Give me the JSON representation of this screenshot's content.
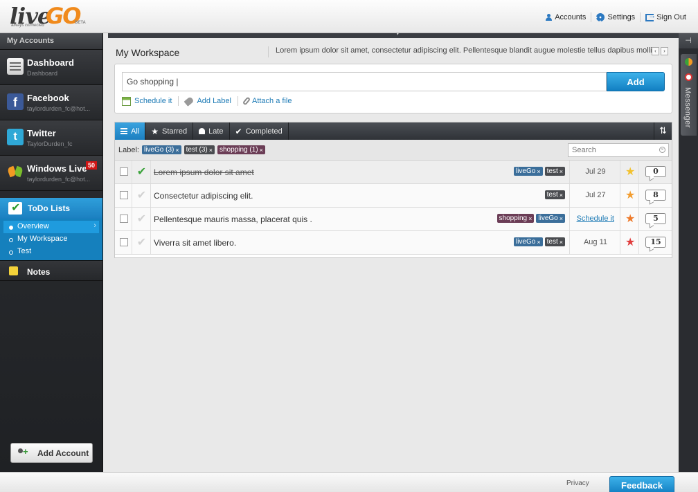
{
  "header": {
    "logo_live": "live",
    "logo_go": "GO",
    "logo_tagline": "always connected",
    "logo_beta": "BETA",
    "nav": [
      {
        "label": "Accounts",
        "icon": "user-icon"
      },
      {
        "label": "Settings",
        "icon": "gear-icon"
      },
      {
        "label": "Sign Out",
        "icon": "sign-out-icon"
      }
    ]
  },
  "sidebar": {
    "heading": "My Accounts",
    "accounts": [
      {
        "name": "Dashboard",
        "sub": "Dashboard",
        "icon": "dashboard-icon"
      },
      {
        "name": "Facebook",
        "sub": "taylordurden_fc@hot...",
        "icon": "facebook-icon"
      },
      {
        "name": "Twitter",
        "sub": "TaylorDurden_fc",
        "icon": "twitter-icon"
      },
      {
        "name": "Windows Live",
        "sub": "taylordurden_fc@hot...",
        "badge": "50",
        "icon": "windows-live-icon"
      }
    ],
    "todo": {
      "label": "ToDo Lists",
      "items": [
        "Overview",
        "My Workspace",
        "Test"
      ],
      "active": "Overview"
    },
    "notes_label": "Notes",
    "add_account_label": "Add Account"
  },
  "workspace": {
    "title": "My Workspace",
    "ticker": "Lorem ipsum dolor sit amet, consectetur adipiscing elit. Pellentesque blandit augue molestie tellus dapibus mollis.",
    "input_value": "Go shopping |",
    "add_label": "Add",
    "options": {
      "schedule": "Schedule it",
      "label": "Add Label",
      "attach": "Attach a file"
    }
  },
  "filters": {
    "all": "All",
    "starred": "Starred",
    "late": "Late",
    "completed": "Completed"
  },
  "labels": {
    "prefix": "Label:",
    "chips": [
      {
        "text": "liveGo (3)",
        "color": "#3b6e9a"
      },
      {
        "text": "test (3)",
        "color": "#4a4c50"
      },
      {
        "text": "shopping (1)",
        "color": "#6b3d56"
      }
    ],
    "search_placeholder": "Search"
  },
  "tasks": [
    {
      "text": "Lorem ipsum dolor sit amet",
      "done": true,
      "tags": [
        {
          "t": "liveGo",
          "c": "#3b6e9a"
        },
        {
          "t": "test",
          "c": "#4a4c50"
        }
      ],
      "date": "Jul 29",
      "schedule": "",
      "star_color": "#f2c12e",
      "comments": "0"
    },
    {
      "text": "Consectetur adipiscing elit.",
      "done": false,
      "tags": [
        {
          "t": "test",
          "c": "#4a4c50"
        }
      ],
      "date": "Jul 27",
      "schedule": "",
      "star_color": "#f29c2e",
      "comments": "8"
    },
    {
      "text": "Pellentesque mauris massa, placerat quis .",
      "done": false,
      "tags": [
        {
          "t": "shopping",
          "c": "#6b3d56"
        },
        {
          "t": "liveGo",
          "c": "#3b6e9a"
        }
      ],
      "date": "",
      "schedule": "Schedule it",
      "star_color": "#ee7a2a",
      "comments": "5"
    },
    {
      "text": "Viverra sit amet libero.",
      "done": false,
      "tags": [
        {
          "t": "liveGo",
          "c": "#3b6e9a"
        },
        {
          "t": "test",
          "c": "#4a4c50"
        }
      ],
      "date": "Aug 11",
      "schedule": "",
      "star_color": "#e03c3c",
      "comments": "15"
    }
  ],
  "messenger": {
    "label": "Messenger"
  },
  "footer": {
    "privacy": "Privacy",
    "feedback": "Feedback"
  }
}
